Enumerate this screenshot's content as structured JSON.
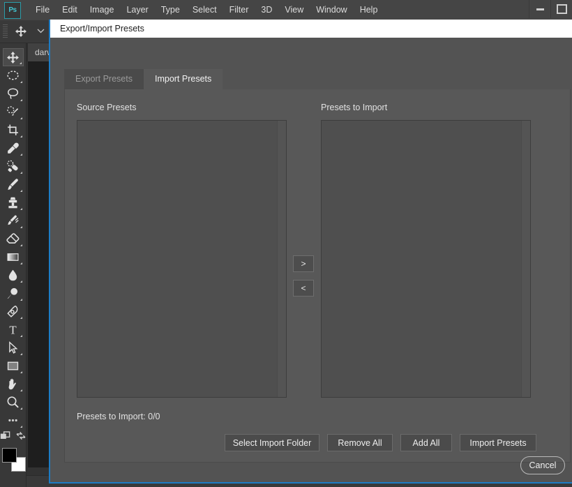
{
  "app": {
    "logo_text": "Ps",
    "menu_items": [
      {
        "label": "File"
      },
      {
        "label": "Edit"
      },
      {
        "label": "Image"
      },
      {
        "label": "Layer"
      },
      {
        "label": "Type"
      },
      {
        "label": "Select"
      },
      {
        "label": "Filter"
      },
      {
        "label": "3D"
      },
      {
        "label": "View"
      },
      {
        "label": "Window"
      },
      {
        "label": "Help"
      }
    ],
    "window_buttons": [
      {
        "name": "minimize-button"
      },
      {
        "name": "maximize-button"
      }
    ],
    "document_tab": "darw",
    "panel_expander": "»"
  },
  "options_bar": {
    "active_tool_icon": "move-tool-icon",
    "preset_chevron": "⌄",
    "checkbox_icon": "▾"
  },
  "toolbar": {
    "tools": [
      {
        "name": "move-tool",
        "icon": "move-icon",
        "selected": true
      },
      {
        "name": "elliptical-marquee-tool",
        "icon": "ellipse-marquee-icon",
        "selected": false
      },
      {
        "name": "lasso-tool",
        "icon": "lasso-icon",
        "selected": false
      },
      {
        "name": "quick-selection-tool",
        "icon": "quick-selection-icon",
        "selected": false
      },
      {
        "name": "crop-tool",
        "icon": "crop-icon",
        "selected": false
      },
      {
        "name": "eyedropper-tool",
        "icon": "eyedropper-icon",
        "selected": false
      },
      {
        "name": "spot-healing-brush-tool",
        "icon": "healing-brush-icon",
        "selected": false
      },
      {
        "name": "brush-tool",
        "icon": "brush-icon",
        "selected": false
      },
      {
        "name": "clone-stamp-tool",
        "icon": "clone-stamp-icon",
        "selected": false
      },
      {
        "name": "history-brush-tool",
        "icon": "history-brush-icon",
        "selected": false
      },
      {
        "name": "eraser-tool",
        "icon": "eraser-icon",
        "selected": false
      },
      {
        "name": "gradient-tool",
        "icon": "gradient-icon",
        "selected": false
      },
      {
        "name": "blur-tool",
        "icon": "blur-droplet-icon",
        "selected": false
      },
      {
        "name": "dodge-tool",
        "icon": "dodge-icon",
        "selected": false
      },
      {
        "name": "pen-tool",
        "icon": "pen-icon",
        "selected": false
      },
      {
        "name": "type-tool",
        "icon": "type-t-icon",
        "selected": false
      },
      {
        "name": "path-selection-tool",
        "icon": "path-arrow-icon",
        "selected": false
      },
      {
        "name": "rectangle-tool",
        "icon": "rectangle-icon",
        "selected": false
      },
      {
        "name": "hand-tool",
        "icon": "hand-icon",
        "selected": false
      },
      {
        "name": "zoom-tool",
        "icon": "magnifier-icon",
        "selected": false
      },
      {
        "name": "edit-toolbar",
        "icon": "ellipsis-icon",
        "selected": false
      }
    ],
    "quick_mask_icon": "quick-mask-icon",
    "screen_mode_icon": "screen-mode-icon",
    "foreground_color": "#000000",
    "background_color": "#ffffff"
  },
  "dialog": {
    "title": "Export/Import Presets",
    "accent_color": "#1d7cc4",
    "tabs": [
      {
        "label": "Export Presets",
        "active": false
      },
      {
        "label": "Import Presets",
        "active": true
      }
    ],
    "source_label": "Source Presets",
    "target_label": "Presets to Import",
    "transfer_buttons": [
      {
        "label": ">",
        "name": "move-right-button"
      },
      {
        "label": "<",
        "name": "move-left-button"
      }
    ],
    "status_text": "Presets to Import: 0/0",
    "action_buttons": [
      {
        "label": "Select Import Folder",
        "name": "select-import-folder-button"
      },
      {
        "label": "Remove All",
        "name": "remove-all-button"
      },
      {
        "label": "Add All",
        "name": "add-all-button"
      },
      {
        "label": "Import Presets",
        "name": "import-presets-button"
      }
    ],
    "cancel_label": "Cancel",
    "source_items": [],
    "target_items": []
  }
}
